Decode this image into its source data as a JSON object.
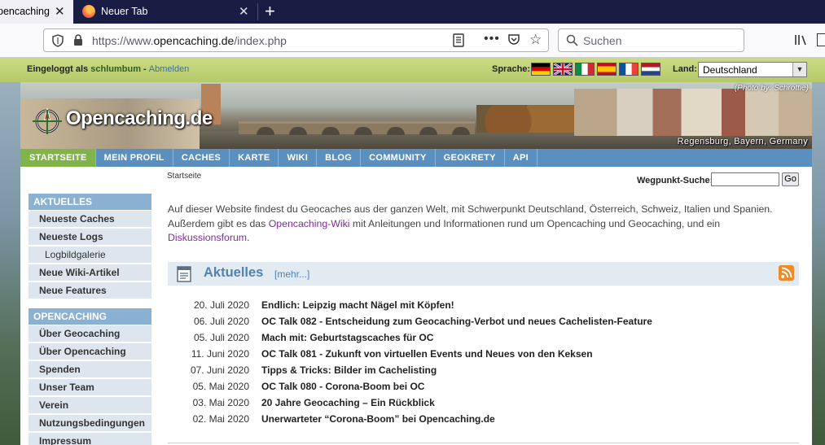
{
  "browser": {
    "tabs": [
      {
        "title": "pencaching",
        "active": true
      },
      {
        "title": "Neuer Tab",
        "active": false
      }
    ],
    "url_prefix": "https://www.",
    "url_domain": "opencaching.de",
    "url_path": "/index.php",
    "search_placeholder": "Suchen"
  },
  "site": {
    "login_label": "Eingeloggt als",
    "username": "schlumbum",
    "separator": " - ",
    "logout": "Abmelden",
    "language_label": "Sprache:",
    "country_label": "Land:",
    "country_selected": "Deutschland",
    "flags": [
      "de",
      "gb",
      "it",
      "es",
      "fr",
      "nl"
    ],
    "logo_text": "Opencaching.de",
    "photo_credit": "(Photo by: Schrottie)",
    "photo_place": "Regensburg, Bayern, Germany",
    "menu": [
      "STARTSEITE",
      "MEIN PROFIL",
      "CACHES",
      "KARTE",
      "WIKI",
      "BLOG",
      "COMMUNITY",
      "GEOKRETY",
      "API"
    ],
    "breadcrumb": "Startseite",
    "waypoint_label": "Wegpunkt-Suche:",
    "waypoint_button": "Go",
    "sidebar": {
      "section1": "AKTUELLES",
      "items1": [
        "Neueste Caches",
        "Neueste Logs",
        "Logbildgalerie",
        "Neue Wiki-Artikel",
        "Neue Features"
      ],
      "section2": "OPENCACHING",
      "items2": [
        "Über Geocaching",
        "Über Opencaching",
        "Spenden",
        "Unser Team",
        "Verein",
        "Nutzungsbedingungen",
        "Impressum"
      ]
    },
    "intro": {
      "part1": "Auf dieser Website findest du Geocaches aus der ganzen Welt, mit Schwerpunkt Deutschland, Österreich, Schweiz, Italien und Spanien. Außerdem gibt es das ",
      "wiki_link": "Opencaching-Wiki",
      "part2": " mit Anleitungen und Informationen rund um Opencaching und Geocaching, und ein ",
      "forum_link": "Diskussionsforum",
      "part3": "."
    },
    "news_title": "Aktuelles",
    "news_more": "[mehr...]",
    "news": [
      {
        "date": "20. Juli 2020",
        "title": "Endlich: Leipzig macht Nägel mit Köpfen!"
      },
      {
        "date": "06. Juli 2020",
        "title": "OC Talk 082 - Entscheidung zum Geocaching-Verbot und neues Cachelisten-Feature"
      },
      {
        "date": "05. Juli 2020",
        "title": "Mach mit: Geburtstagscaches für OC"
      },
      {
        "date": "11. Juni 2020",
        "title": "OC Talk 081 - Zukunft von virtuellen Events und Neues von den Keksen"
      },
      {
        "date": "07. Juni 2020",
        "title": "Tipps & Tricks: Bilder im Cachelisting"
      },
      {
        "date": "05. Mai 2020",
        "title": "OC Talk 080 - Corona-Boom bei OC"
      },
      {
        "date": "03. Mai 2020",
        "title": "20 Jahre Geocaching – Ein Rückblick"
      },
      {
        "date": "02. Mai 2020",
        "title": "Unerwarteter “Corona-Boom” bei Opencaching.de"
      }
    ]
  }
}
